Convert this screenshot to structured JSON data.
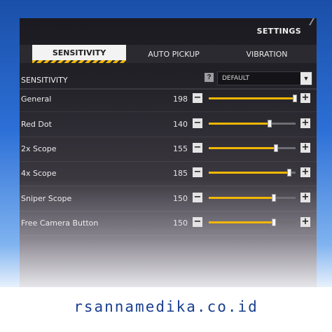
{
  "header": {
    "title": "SETTINGS"
  },
  "tabs": [
    {
      "label": "SENSITIVITY",
      "active": true
    },
    {
      "label": "AUTO PICKUP",
      "active": false
    },
    {
      "label": "VIBRATION",
      "active": false
    }
  ],
  "sensitivity": {
    "section_label": "SENSITIVITY",
    "help_icon": "?",
    "preset": "DEFAULT",
    "minus_symbol": "−",
    "plus_symbol": "+"
  },
  "settings": [
    {
      "label": "General",
      "value": "198",
      "level": 0.99
    },
    {
      "label": "Red Dot",
      "value": "140",
      "level": 0.7
    },
    {
      "label": "2x Scope",
      "value": "155",
      "level": 0.775
    },
    {
      "label": "4x Scope",
      "value": "185",
      "level": 0.925
    },
    {
      "label": "Sniper Scope",
      "value": "150",
      "level": 0.75
    },
    {
      "label": "Free Camera Button",
      "value": "150",
      "level": 0.75
    }
  ],
  "colors": {
    "accent": "#f2b705",
    "footer_text": "#1a3f8f",
    "frame_blue": "#2c6fd6"
  },
  "footer": {
    "watermark": "rsannamedika.co.id"
  }
}
